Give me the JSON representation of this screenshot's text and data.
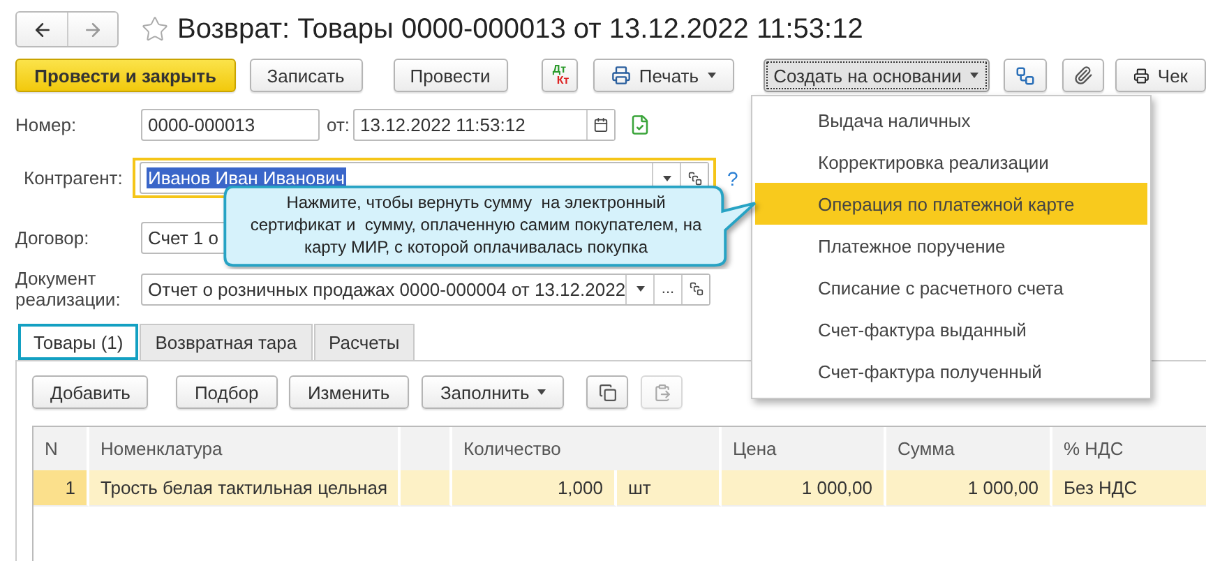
{
  "window": {
    "title": "Возврат: Товары 0000-000013 от 13.12.2022 11:53:12",
    "favorite": false
  },
  "toolbar": {
    "buttons": [
      {
        "kind": "primary",
        "label": "Провести и закрыть"
      },
      {
        "kind": "plain",
        "label": "Записать"
      },
      {
        "kind": "plain",
        "label": "Провести"
      },
      {
        "kind": "dtkt",
        "label": "Дт",
        "label_2": "Кт"
      },
      {
        "kind": "print",
        "label": "Печать"
      },
      {
        "kind": "menu",
        "label": "Создать на основании",
        "expanded": true
      },
      {
        "kind": "structure"
      },
      {
        "kind": "attach"
      },
      {
        "kind": "receipt",
        "label": "Чек"
      }
    ]
  },
  "fields": {
    "number": {
      "label": "Номер:",
      "value": "0000-000013"
    },
    "date": {
      "label": "от:",
      "value": "13.12.2022 11:53:12"
    },
    "counterparty": {
      "label": "Контрагент:",
      "value": "Иванов Иван Иванович",
      "focused": true,
      "help": "?"
    },
    "contract": {
      "label": "Договор:",
      "value": "Счет 1 о"
    },
    "sale_document": {
      "label": "Документ реализации:",
      "value": "Отчет о розничных продажах 0000-000004 от 13.12.2022",
      "more": "..."
    }
  },
  "tabs": [
    {
      "label": "Товары (1)",
      "selected": true
    },
    {
      "label": "Возвратная тара",
      "selected": false
    },
    {
      "label": "Расчеты",
      "selected": false
    }
  ],
  "table_toolbar": {
    "buttons": [
      {
        "kind": "plain",
        "label": "Добавить",
        "disabled": false
      },
      {
        "kind": "plain",
        "label": "Подбор",
        "disabled": false
      },
      {
        "kind": "plain",
        "label": "Изменить",
        "disabled": false
      },
      {
        "kind": "dropdown",
        "label": "Заполнить",
        "disabled": false
      },
      {
        "kind": "copy",
        "disabled": false
      },
      {
        "kind": "paste",
        "disabled": true
      }
    ]
  },
  "table": {
    "columns": [
      "N",
      "Номенклатура",
      "",
      "Количество",
      "",
      "Цена",
      "Сумма",
      "% НДС"
    ],
    "rows": [
      {
        "selected": true,
        "cells": [
          "1",
          "Трость белая тактильная цельная",
          "",
          "1,000",
          "шт",
          "1 000,00",
          "1 000,00",
          "Без НДС"
        ]
      }
    ]
  },
  "menu": {
    "items": [
      {
        "label": "Выдача наличных",
        "selected": false
      },
      {
        "label": "Корректировка реализации",
        "selected": false
      },
      {
        "label": "Операция по платежной карте",
        "selected": true
      },
      {
        "label": "Платежное поручение",
        "selected": false
      },
      {
        "label": "Списание с расчетного счета",
        "selected": false
      },
      {
        "label": "Счет-фактура выданный",
        "selected": false
      },
      {
        "label": "Счет-фактура полученный",
        "selected": false
      }
    ]
  },
  "callout": {
    "text": "Нажмите, чтобы вернуть сумму  на электронный сертификат и  сумму, оплаченную самим покупателем, на карту МИР, с которой оплачивалась покупка"
  }
}
